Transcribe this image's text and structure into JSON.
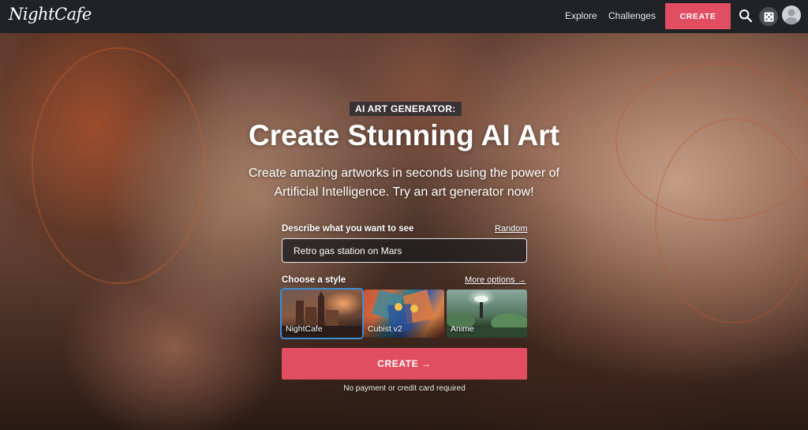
{
  "nav": {
    "logo": "NightCafe",
    "links": [
      "Explore",
      "Challenges"
    ],
    "create_label": "CREATE",
    "icons": [
      "search-icon",
      "dice-icon",
      "avatar"
    ]
  },
  "hero": {
    "eyebrow": "AI ART GENERATOR:",
    "headline": "Create Stunning AI Art",
    "subtitle_line1": "Create amazing artworks in seconds using the power of",
    "subtitle_line2": "Artificial Intelligence. Try an art generator now!"
  },
  "form": {
    "prompt_label": "Describe what you want to see",
    "random_label": "Random",
    "prompt_value": "Retro gas station on Mars",
    "style_label": "Choose a style",
    "more_options_label": "More options →",
    "styles": [
      {
        "name": "NightCafe",
        "selected": true
      },
      {
        "name": "Cubist v2",
        "selected": false
      },
      {
        "name": "Anime",
        "selected": false
      }
    ],
    "create_label": "CREATE →",
    "footnote": "No payment or credit card required"
  },
  "colors": {
    "accent": "#e14e62",
    "navbar": "#1f2326",
    "selected_outline": "#3c8dd6"
  }
}
